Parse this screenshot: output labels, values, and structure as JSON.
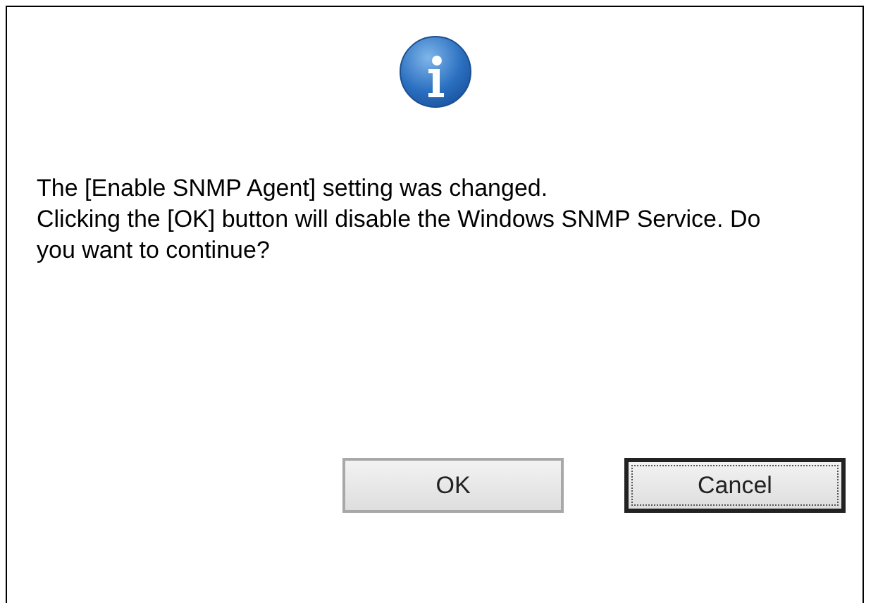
{
  "message": [
    "The [Enable SNMP Agent] setting was changed.",
    "Clicking the [OK] button will disable the Windows SNMP Service. Do you want to continue?"
  ],
  "buttons": [
    {
      "label": "OK",
      "focused": false
    },
    {
      "label": "Cancel",
      "focused": true
    }
  ]
}
